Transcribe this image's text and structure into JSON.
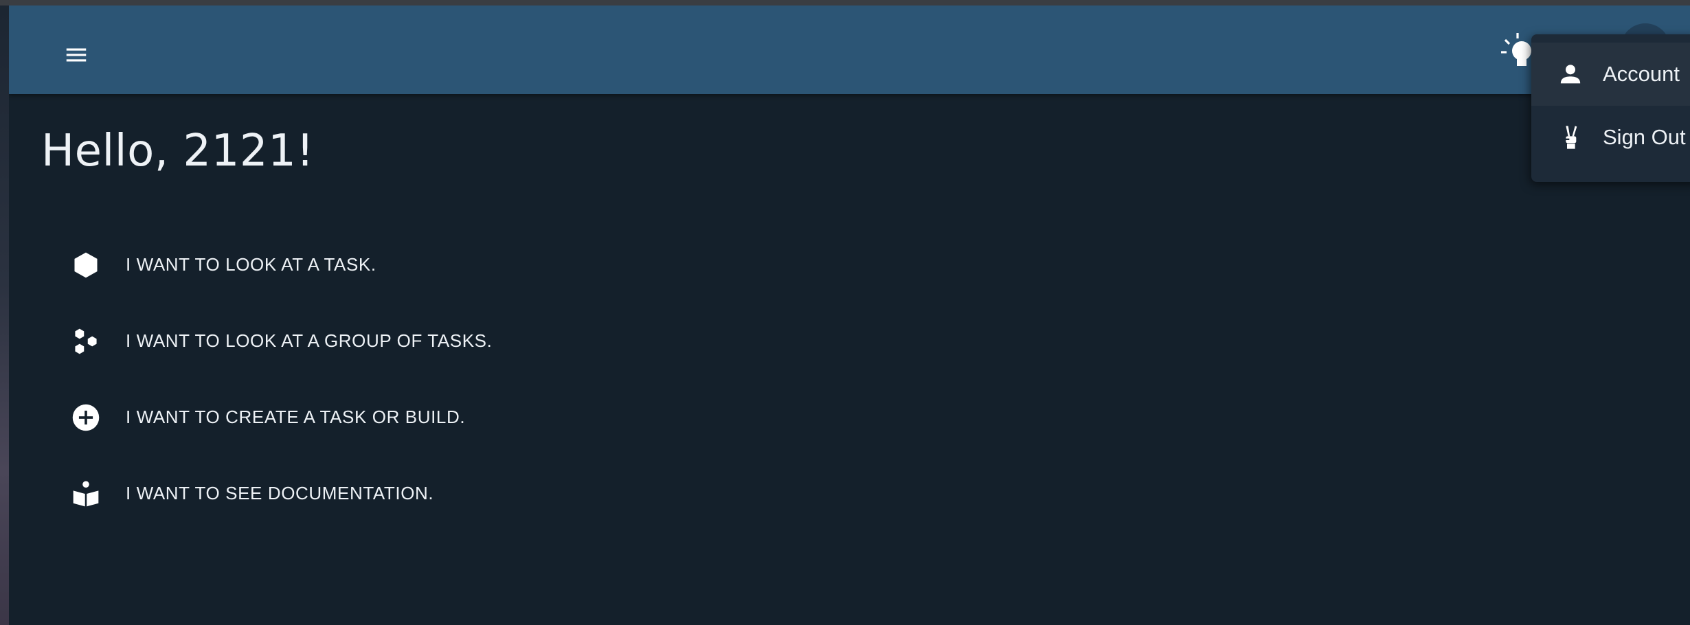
{
  "header": {
    "menu_icon": "hamburger-menu-icon",
    "theme_icon": "lightbulb-icon",
    "avatar_icon": "user-avatar"
  },
  "main": {
    "greeting": "Hello, 2121!",
    "actions": [
      {
        "icon": "hexagon-icon",
        "label": "I WANT TO LOOK AT A TASK."
      },
      {
        "icon": "hexagon-group-icon",
        "label": "I WANT TO LOOK AT A GROUP OF TASKS."
      },
      {
        "icon": "plus-circle-icon",
        "label": "I WANT TO CREATE A TASK OR BUILD."
      },
      {
        "icon": "book-reader-icon",
        "label": "I WANT TO SEE DOCUMENTATION."
      }
    ]
  },
  "user_menu": {
    "items": [
      {
        "icon": "person-icon",
        "label": "Account"
      },
      {
        "icon": "peace-hand-icon",
        "label": "Sign Out"
      }
    ]
  },
  "colors": {
    "appbar": "#2c5575",
    "background": "#14202b",
    "menu_background": "#1d2a38",
    "text": "#eef2f6"
  }
}
